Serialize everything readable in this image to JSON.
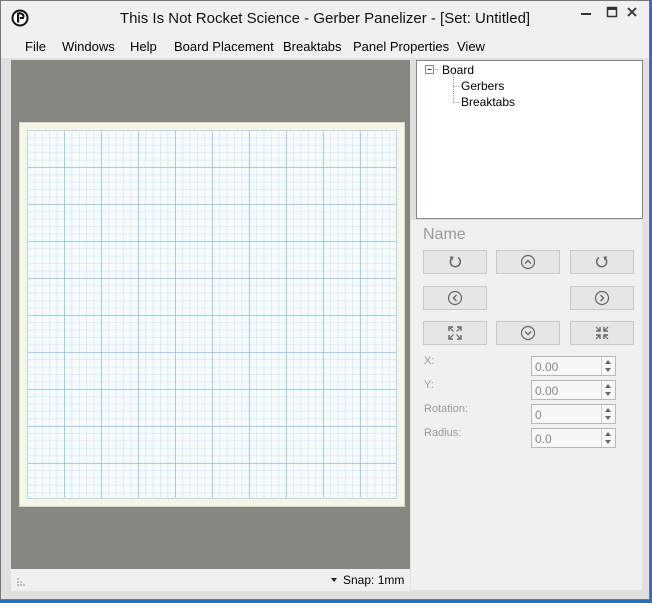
{
  "window": {
    "title": "This Is Not Rocket Science - Gerber Panelizer - [Set: Untitled]",
    "controls": [
      "minimize",
      "maximize",
      "close"
    ]
  },
  "menu": {
    "items": [
      "File",
      "Windows",
      "Help",
      "Board Placement",
      "Breaktabs",
      "Panel Properties",
      "View"
    ]
  },
  "status": {
    "snap_label": "Snap: 1mm"
  },
  "tree": {
    "root": "Board",
    "children": [
      "Gerbers",
      "Breaktabs"
    ]
  },
  "panel": {
    "name_label": "Name",
    "buttons": [
      "rotate-ccw-icon",
      "move-up-icon",
      "rotate-cw-icon",
      "move-left-icon",
      "move-right-icon",
      "expand-icon",
      "move-down-icon",
      "collapse-icon"
    ],
    "fields": [
      {
        "label": "X:",
        "value": "0.00"
      },
      {
        "label": "Y:",
        "value": "0.00"
      },
      {
        "label": "Rotation:",
        "value": "0"
      },
      {
        "label": "Radius:",
        "value": "0.0"
      }
    ]
  },
  "colors": {
    "canvas_bg": "#878782",
    "board_bg": "#f5f5e8",
    "grid_line": "#78b4e1",
    "disabled_text": "#9a9a9a"
  }
}
